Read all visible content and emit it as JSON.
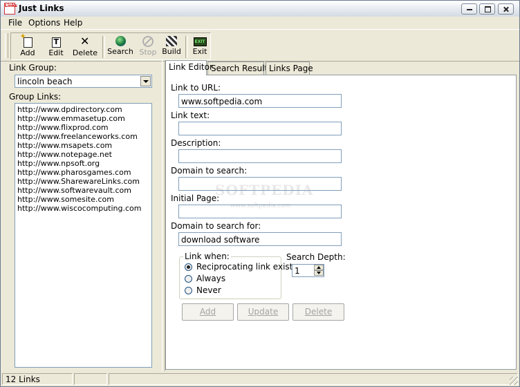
{
  "window": {
    "title": "Just Links",
    "icon_text": "Links"
  },
  "menu": [
    "File",
    "Options",
    "Help"
  ],
  "toolbar": {
    "add": "Add",
    "edit": "Edit",
    "delete": "Delete",
    "search": "Search",
    "stop": "Stop",
    "build": "Build",
    "exit": "Exit",
    "exit_icon_text": "EXIT"
  },
  "left": {
    "link_group_label": "Link Group:",
    "link_group_value": "lincoln beach",
    "group_links_label": "Group Links:",
    "links": [
      "http://www.dpdirectory.com",
      "http://www.emmasetup.com",
      "http://www.flixprod.com",
      "http://www.freelanceworks.com",
      "http://www.msapets.com",
      "http://www.notepage.net",
      "http://www.npsoft.org",
      "http://www.pharosgames.com",
      "http://www.SharewareLinks.com",
      "http://www.softwarevault.com",
      "http://www.somesite.com",
      "http://www.wiscocomputing.com"
    ]
  },
  "tabs": [
    "Link Editor",
    "Search Results",
    "Links Page"
  ],
  "form": {
    "link_url_label": "Link to URL:",
    "link_url_value": "www.softpedia.com",
    "link_text_label": "Link text:",
    "link_text_value": "",
    "description_label": "Description:",
    "description_value": "",
    "domain_search_label": "Domain to search:",
    "domain_search_value": "",
    "initial_page_label": "Initial Page:",
    "initial_page_value": "",
    "domain_for_label": "Domain to search for:",
    "domain_for_value": "download software",
    "link_when_label": "Link when:",
    "radios": [
      "Reciprocating link exists",
      "Always",
      "Never"
    ],
    "selected_radio": "Reciprocating link exists",
    "search_depth_label": "Search Depth:",
    "search_depth_value": "1",
    "add_button": "Add",
    "update_button": "Update",
    "delete_button": "Delete"
  },
  "watermark": {
    "main": "SOFTPEDIA",
    "sub": "www.softpedia.com"
  },
  "status": {
    "count": "12 Links"
  }
}
